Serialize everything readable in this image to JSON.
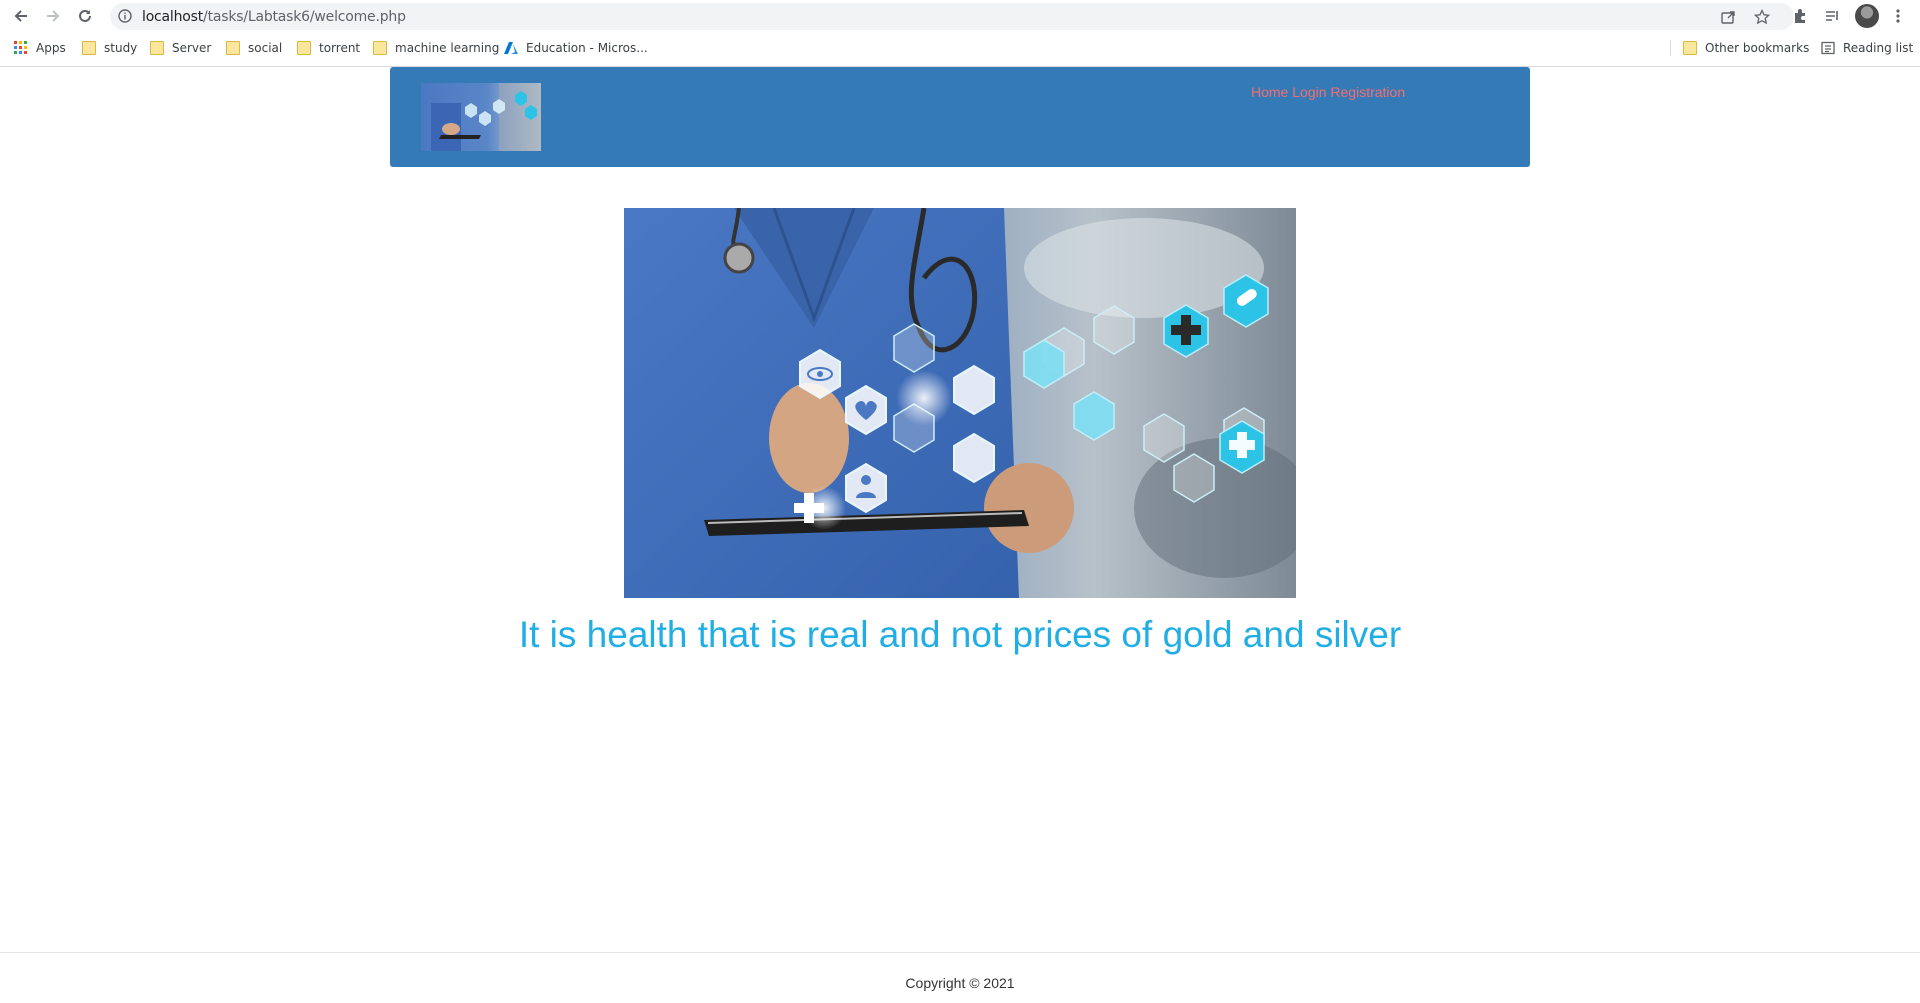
{
  "browser": {
    "url_host": "localhost",
    "url_path": "/tasks/Labtask6/welcome.php",
    "bookmarks": [
      {
        "label": "Apps"
      },
      {
        "label": "study"
      },
      {
        "label": "Server"
      },
      {
        "label": "social"
      },
      {
        "label": "torrent"
      },
      {
        "label": "machine learning"
      },
      {
        "label": "Education - Micros..."
      }
    ],
    "other_bookmarks": "Other bookmarks",
    "reading_list": "Reading list"
  },
  "header": {
    "nav": {
      "home": "Home",
      "login": "Login",
      "registration": "Registration"
    }
  },
  "main": {
    "tagline": "It is health that is real and not prices of gold and silver"
  },
  "footer": {
    "copyright": "Copyright © 2021"
  },
  "colors": {
    "header_bg": "#337ab7",
    "nav_link": "#f56e6e",
    "tagline": "#21aee5"
  }
}
